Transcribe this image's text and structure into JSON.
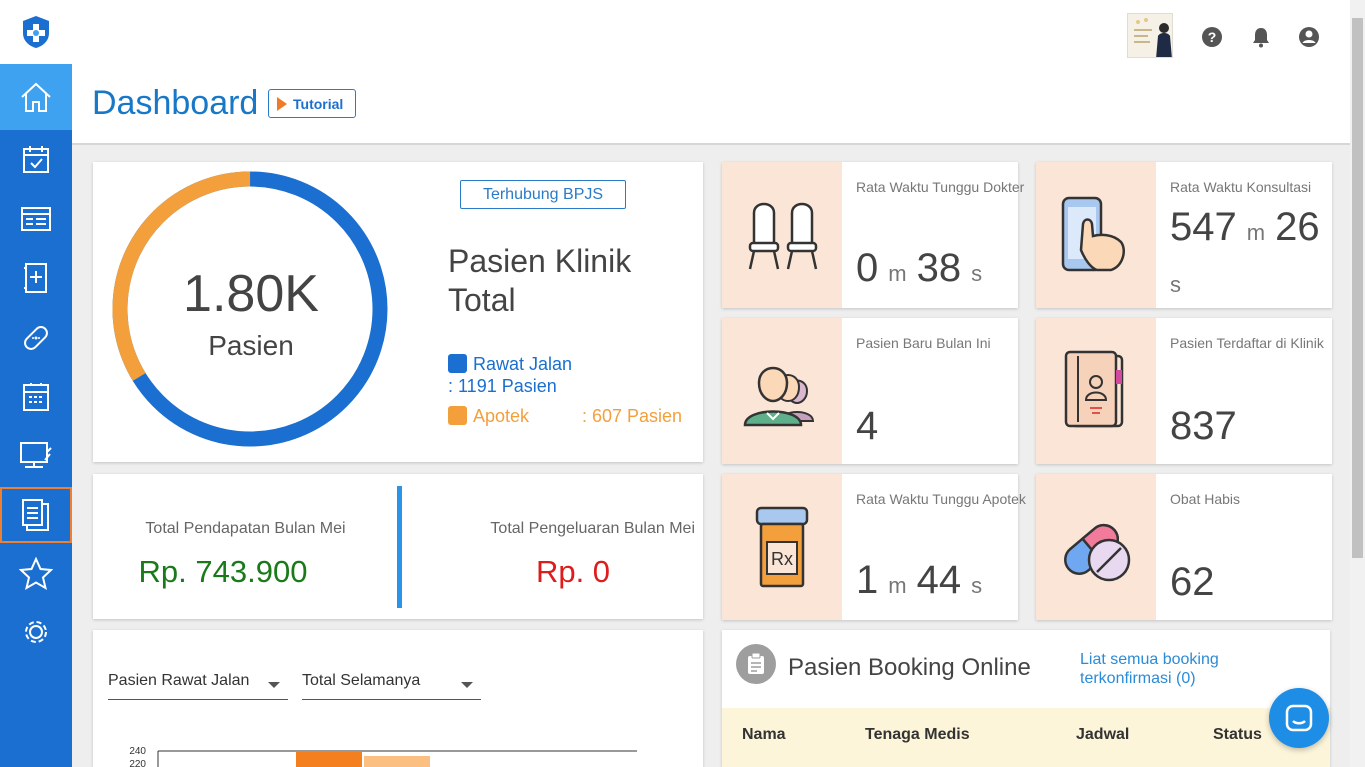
{
  "header": {
    "title": "Dashboard",
    "tutorial_label": "Tutorial"
  },
  "topbar": {
    "icons": [
      "help-icon",
      "bell-icon",
      "account-icon"
    ]
  },
  "sidebar": {
    "items": [
      {
        "name": "home-icon"
      },
      {
        "name": "calendar-check-icon"
      },
      {
        "name": "id-card-icon"
      },
      {
        "name": "medical-book-icon"
      },
      {
        "name": "bandage-icon"
      },
      {
        "name": "register-icon"
      },
      {
        "name": "monitor-icon"
      },
      {
        "name": "clipboard-icon"
      },
      {
        "name": "star-icon"
      },
      {
        "name": "settings-icon"
      }
    ]
  },
  "patients": {
    "bpjs_label": "Terhubung BPJS",
    "total_value": "1.80K",
    "total_unit": "Pasien",
    "title_line1": "Pasien Klinik",
    "title_line2": "Total",
    "legend": [
      {
        "label": "Rawat Jalan",
        "value": ": 1191 Pasien",
        "color": "#1a6fd0",
        "count": 1191
      },
      {
        "label": "Apotek",
        "value": ": 607 Pasien",
        "color": "#f3a03c",
        "count": 607
      }
    ]
  },
  "finance": {
    "income_label": "Total Pendapatan Bulan Mei",
    "income_value": "Rp. 743.900",
    "expense_label": "Total Pengeluaran Bulan Mei",
    "expense_value": "Rp. 0"
  },
  "stats": {
    "wait_doctor": {
      "label": "Rata Waktu Tunggu Dokter",
      "min": "0",
      "m": "m",
      "sec": "38",
      "s": "s"
    },
    "consult": {
      "label": "Rata Waktu Konsultasi",
      "min": "547",
      "m": "m",
      "sec": "26",
      "s": "s"
    },
    "new_patients": {
      "label": "Pasien Baru Bulan Ini",
      "value": "4"
    },
    "registered": {
      "label": "Pasien Terdaftar di Klinik",
      "value": "837"
    },
    "wait_pharmacy": {
      "label": "Rata Waktu Tunggu Apotek",
      "min": "1",
      "m": "m",
      "sec": "44",
      "s": "s"
    },
    "out_of_stock": {
      "label": "Obat Habis",
      "value": "62"
    }
  },
  "chart_filters": {
    "type_value": "Pasien Rawat Jalan",
    "range_value": "Total Selamanya"
  },
  "chart_data": {
    "type": "bar",
    "ticks": [
      "240",
      "220"
    ]
  },
  "booking": {
    "title": "Pasien Booking Online",
    "link": "Liat semua booking terkonfirmasi (0)",
    "columns": [
      "Nama",
      "Tenaga Medis",
      "Jadwal",
      "Status"
    ]
  }
}
